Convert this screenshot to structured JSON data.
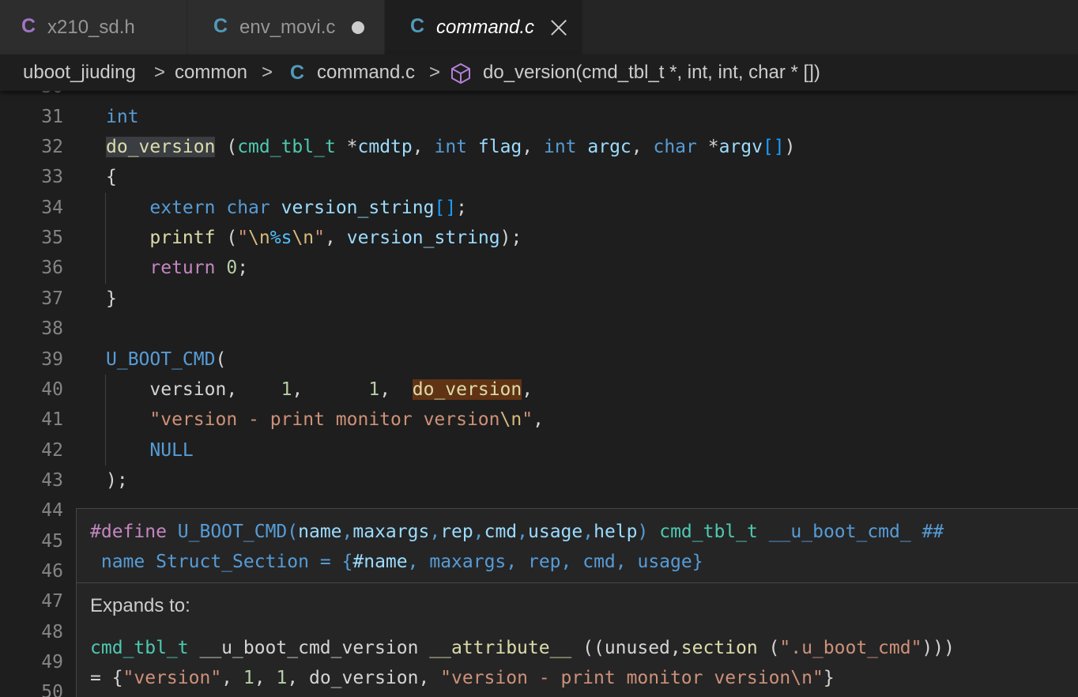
{
  "tabs": [
    {
      "icon": "C",
      "name": "x210_sd.h",
      "active": false
    },
    {
      "icon": "C",
      "name": "env_movi.c",
      "active": false,
      "modified": true
    },
    {
      "icon": "C",
      "name": "command.c",
      "active": true
    }
  ],
  "breadcrumb": {
    "items": [
      "uboot_jiuding",
      "common",
      "command.c",
      "do_version(cmd_tbl_t *, int, int, char * [])"
    ],
    "file_icon": "C",
    "separator": ">"
  },
  "colors": {
    "editor_bg": "#1e1e1e",
    "tab_icon_header": "#a074c4",
    "tab_icon_c": "#519aba",
    "keyword": "#569cd6",
    "control": "#c586c0",
    "type": "#4ec9b0",
    "function": "#dcdcaa",
    "variable": "#9cdcfe",
    "string": "#ce9178",
    "number": "#b5cea8"
  },
  "editor": {
    "line_numbers": [
      "31",
      "32",
      "33",
      "34",
      "35",
      "36",
      "37",
      "38",
      "39",
      "40",
      "41",
      "42",
      "43",
      "44",
      "45",
      "46",
      "47",
      "48",
      "49",
      "50"
    ],
    "lines": {
      "l31": [
        "int"
      ],
      "l32": [
        "do_version",
        " (",
        "cmd_tbl_t",
        " *",
        "cmdtp",
        ", ",
        "int",
        " ",
        "flag",
        ", ",
        "int",
        " ",
        "argc",
        ", ",
        "char",
        " *",
        "argv",
        "[]",
        ")"
      ],
      "l33": [
        "{"
      ],
      "l34": [
        "    ",
        "extern",
        " ",
        "char",
        " ",
        "version_string",
        "[]",
        ";"
      ],
      "l35": [
        "    ",
        "printf",
        " (",
        "\"",
        "\\n",
        "%s",
        "\\n",
        "\"",
        ", ",
        "version_string",
        ");"
      ],
      "l36": [
        "    ",
        "return",
        " ",
        "0",
        ";"
      ],
      "l37": [
        "}"
      ],
      "l39": [
        "U_BOOT_CMD",
        "("
      ],
      "l40": [
        "    ",
        "version,    ",
        "1",
        ",      ",
        "1",
        ",  ",
        "do_version",
        ","
      ],
      "l41": [
        "    ",
        "\"version - print monitor version",
        "\\n",
        "\"",
        ","
      ],
      "l42": [
        "    ",
        "NULL"
      ],
      "l43": [
        ");"
      ]
    }
  },
  "hover": {
    "define_line1": [
      "#define",
      " ",
      "U_BOOT_CMD",
      "(",
      "name",
      ",",
      "maxargs",
      ",",
      "rep",
      ",",
      "cmd",
      ",",
      "usage",
      ",",
      "help",
      ")",
      " ",
      "cmd_tbl_t",
      " ",
      "__u_boot_cmd_",
      " ",
      "##"
    ],
    "define_line2": [
      " ",
      "name",
      " ",
      "Struct_Section",
      " = ",
      "{",
      "#name",
      ", ",
      "maxargs",
      ", ",
      "rep",
      ", ",
      "cmd",
      ", ",
      "usage",
      "}"
    ],
    "expands_label": "Expands to:",
    "expansion_line1": [
      "cmd_tbl_t",
      " __u_boot_cmd_version ",
      "__attribute__",
      " ((unused,",
      "section",
      " (",
      "\".u_boot_cmd\"",
      ")))"
    ],
    "expansion_line2": [
      "= {",
      "\"version\"",
      ", ",
      "1",
      ", ",
      "1",
      ", do_version, ",
      "\"version - print monitor version\\n\"",
      "}"
    ]
  }
}
